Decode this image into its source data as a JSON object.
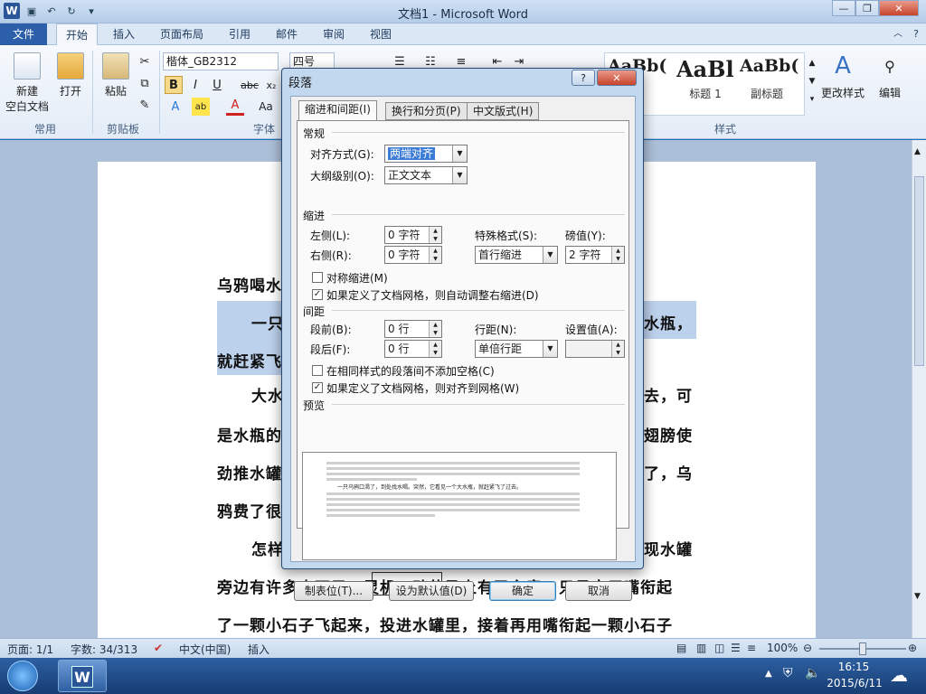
{
  "window": {
    "title": "文档1 - Microsoft Word",
    "app_icon": "word-icon"
  },
  "quick_access": [
    "save-icon",
    "undo-icon",
    "redo-icon",
    "customize-icon"
  ],
  "ribbon_tabs": [
    {
      "label": "文件",
      "state": "file"
    },
    {
      "label": "开始",
      "state": "active"
    },
    {
      "label": "插入",
      "state": ""
    },
    {
      "label": "页面布局",
      "state": ""
    },
    {
      "label": "引用",
      "state": ""
    },
    {
      "label": "邮件",
      "state": ""
    },
    {
      "label": "审阅",
      "state": ""
    },
    {
      "label": "视图",
      "state": ""
    }
  ],
  "ribbon": {
    "common": {
      "new_doc_line1": "新建",
      "new_doc_line2": "空白文档",
      "open": "打开",
      "group": "常用"
    },
    "clipboard": {
      "paste": "粘贴",
      "group": "剪贴板"
    },
    "font": {
      "name": "楷体_GB2312",
      "size": "四号",
      "group": "字体",
      "bold": "B",
      "italic": "I",
      "underline": "U",
      "strike": "abc",
      "sub": "x₂",
      "aa": "Aa"
    },
    "styles": {
      "samples": [
        {
          "sample": "AaBb(",
          "name": ""
        },
        {
          "sample": "AaBl",
          "name": "标题 1"
        },
        {
          "sample": "AaBb(",
          "name": "副标题"
        }
      ],
      "group": "样式",
      "change_styles": "更改样式"
    },
    "editing": {
      "label": "编辑"
    }
  },
  "document": {
    "title_fragment": "乌鸦喝水",
    "lines": [
      {
        "left": "一只",
        "right": "水瓶，",
        "highlight": true,
        "indent": true
      },
      {
        "left": "就赶紧飞",
        "right": "",
        "highlight": true,
        "indent": false
      },
      {
        "left": "大水",
        "right": "去，可",
        "highlight": false,
        "indent": true
      },
      {
        "left": "是水瓶的",
        "right": "翅膀使",
        "highlight": false,
        "indent": false
      },
      {
        "left": "劲推水罐",
        "right": "了，乌",
        "highlight": false,
        "indent": false
      },
      {
        "left": "鸦费了很",
        "right": "",
        "highlight": false,
        "indent": false
      },
      {
        "left": "怎样",
        "right": "现水罐",
        "highlight": false,
        "indent": true
      },
      {
        "left": "旁边有许多小石子，灵机一动使马上有了主意。只见它用嘴衔起",
        "right": "",
        "highlight": false,
        "indent": false
      },
      {
        "left": "了一颗小石子飞起来，投进水罐里，接着再用嘴衔起一颗小石子",
        "right": "",
        "highlight": false,
        "indent": false
      }
    ]
  },
  "dialog": {
    "title": "段落",
    "help": "?",
    "close": "✕",
    "tabs": [
      "缩进和间距(I)",
      "换行和分页(P)",
      "中文版式(H)"
    ],
    "general": {
      "section": "常规",
      "alignment_label": "对齐方式(G):",
      "alignment_value": "两端对齐",
      "outline_label": "大纲级别(O):",
      "outline_value": "正文文本"
    },
    "indent": {
      "section": "缩进",
      "left_label": "左侧(L):",
      "left_value": "0 字符",
      "right_label": "右侧(R):",
      "right_value": "0 字符",
      "special_label": "特殊格式(S):",
      "special_value": "首行缩进",
      "by_label": "磅值(Y):",
      "by_value": "2 字符",
      "mirror_label": "对称缩进(M)",
      "mirror_checked": false,
      "auto_adjust_label": "如果定义了文档网格，则自动调整右缩进(D)",
      "auto_adjust_checked": true
    },
    "spacing": {
      "section": "间距",
      "before_label": "段前(B):",
      "before_value": "0 行",
      "after_label": "段后(F):",
      "after_value": "0 行",
      "line_label": "行距(N):",
      "line_value": "单倍行距",
      "at_label": "设置值(A):",
      "at_value": "",
      "no_space_label": "在相同样式的段落间不添加空格(C)",
      "no_space_checked": false,
      "snap_label": "如果定义了文档网格，则对齐到网格(W)",
      "snap_checked": true
    },
    "preview": {
      "section": "预览",
      "sample_text": "一只乌鸦口渴了，到处找水喝。突然，它看见一个大水瓶，就赶紧飞了过去。"
    },
    "buttons": {
      "tabs": "制表位(T)...",
      "default": "设为默认值(D)",
      "ok": "确定",
      "cancel": "取消"
    }
  },
  "status": {
    "page": "页面: 1/1",
    "words": "字数: 34/313",
    "language": "中文(中国)",
    "mode": "插入",
    "zoom": "100%"
  },
  "taskbar": {
    "time": "16:15",
    "date": "2015/6/11"
  }
}
